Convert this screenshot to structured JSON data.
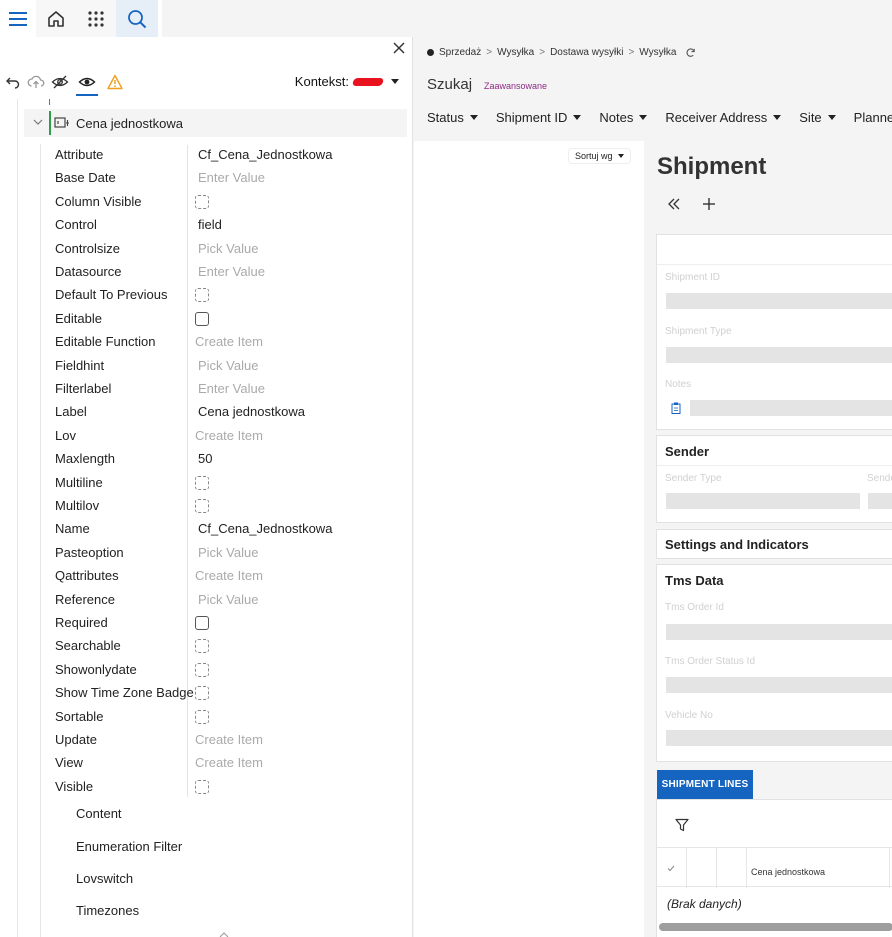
{
  "topnav": {
    "icons": [
      "menu-icon",
      "home-icon",
      "apps-grid-icon",
      "search-icon"
    ]
  },
  "colors": {
    "accent": "#1565c0",
    "tree_green": "#2e9e4a",
    "warning": "#f0a020",
    "advanced_link": "#8e2c83"
  },
  "panel": {
    "kontekst_label": "Kontekst:",
    "node_label": "Cena jednostkowa",
    "properties": [
      {
        "name": "Attribute",
        "kind": "text",
        "value": "Cf_Cena_Jednostkowa"
      },
      {
        "name": "Base Date",
        "kind": "placeholder",
        "value": "Enter Value"
      },
      {
        "name": "Column Visible",
        "kind": "dashcheck",
        "value": ""
      },
      {
        "name": "Control",
        "kind": "text",
        "value": "field"
      },
      {
        "name": "Controlsize",
        "kind": "placeholder",
        "value": "Pick Value"
      },
      {
        "name": "Datasource",
        "kind": "placeholder",
        "value": "Enter Value"
      },
      {
        "name": "Default To Previous",
        "kind": "dashcheck",
        "value": ""
      },
      {
        "name": "Editable",
        "kind": "check",
        "value": ""
      },
      {
        "name": "Editable Function",
        "kind": "placeholder2",
        "value": "Create Item"
      },
      {
        "name": "Fieldhint",
        "kind": "placeholder",
        "value": "Pick Value"
      },
      {
        "name": "Filterlabel",
        "kind": "placeholder",
        "value": "Enter Value"
      },
      {
        "name": "Label",
        "kind": "text",
        "value": "Cena jednostkowa"
      },
      {
        "name": "Lov",
        "kind": "placeholder2",
        "value": "Create Item"
      },
      {
        "name": "Maxlength",
        "kind": "text",
        "value": "50"
      },
      {
        "name": "Multiline",
        "kind": "dashcheck",
        "value": ""
      },
      {
        "name": "Multilov",
        "kind": "dashcheck",
        "value": ""
      },
      {
        "name": "Name",
        "kind": "text",
        "value": "Cf_Cena_Jednostkowa"
      },
      {
        "name": "Pasteoption",
        "kind": "placeholder",
        "value": "Pick Value"
      },
      {
        "name": "Qattributes",
        "kind": "placeholder2",
        "value": "Create Item"
      },
      {
        "name": "Reference",
        "kind": "placeholder",
        "value": "Pick Value"
      },
      {
        "name": "Required",
        "kind": "check",
        "value": ""
      },
      {
        "name": "Searchable",
        "kind": "dashcheck",
        "value": ""
      },
      {
        "name": "Showonlydate",
        "kind": "dashcheck",
        "value": ""
      },
      {
        "name": "Show Time Zone Badge",
        "kind": "dashcheck",
        "value": ""
      },
      {
        "name": "Sortable",
        "kind": "dashcheck",
        "value": ""
      },
      {
        "name": "Update",
        "kind": "placeholder2",
        "value": "Create Item"
      },
      {
        "name": "View",
        "kind": "placeholder2",
        "value": "Create Item"
      },
      {
        "name": "Visible",
        "kind": "dashcheck",
        "value": ""
      }
    ],
    "subnodes": [
      "Content",
      "Enumeration Filter",
      "Lovswitch",
      "Timezones"
    ]
  },
  "breadcrumb": [
    "Sprzedaż",
    "Wysyłka",
    "Dostawa wysyłki",
    "Wysyłka"
  ],
  "search": {
    "title": "Szukaj",
    "advanced": "Zaawansowane",
    "filters": [
      "Status",
      "Shipment ID",
      "Notes",
      "Receiver Address",
      "Site",
      "Planned S"
    ]
  },
  "list": {
    "sort_label": "Sortuj wg"
  },
  "detail": {
    "title": "Shipment",
    "card1": {
      "fields": [
        "Shipment ID",
        "Shipment Type",
        "Notes"
      ]
    },
    "sender": {
      "header": "Sender",
      "fields": [
        "Sender Type",
        "Sende"
      ]
    },
    "settings_header": "Settings and Indicators",
    "tms": {
      "header": "Tms Data",
      "fields": [
        "Tms Order Id",
        "Tms Order Status Id",
        "Vehicle No"
      ]
    },
    "lines_tab": "SHIPMENT LINES",
    "lines_column": "Cena jednostkowa",
    "lines_empty": "(Brak danych)"
  }
}
